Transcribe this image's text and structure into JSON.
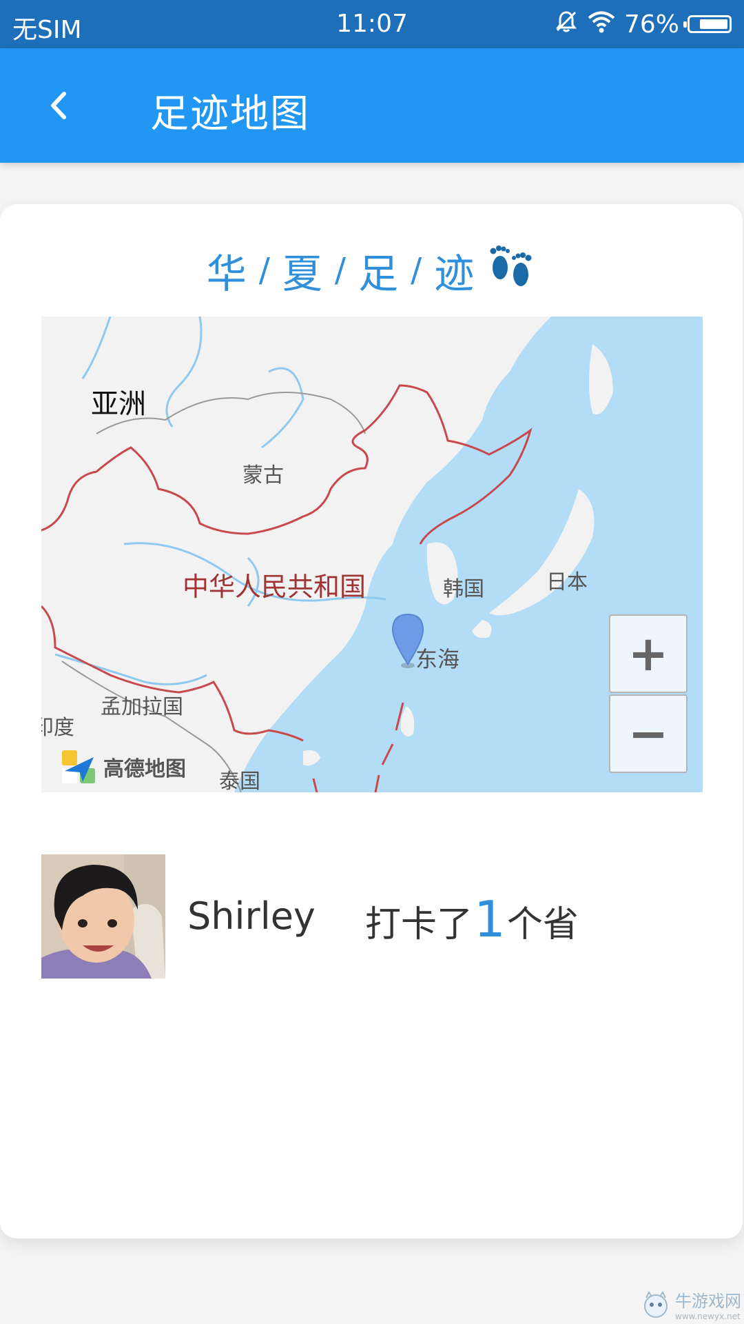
{
  "status_bar": {
    "carrier": "无SIM",
    "time": "11:07",
    "battery_percent": "76%",
    "battery_level": 0.76,
    "icons": [
      "bell-muted-icon",
      "wifi-icon",
      "battery-icon"
    ]
  },
  "header": {
    "title": "足迹地图",
    "back_icon": "chevron-left-icon"
  },
  "card": {
    "heading_chars": [
      "华",
      "夏",
      "足",
      "迹"
    ],
    "heading_separator": "/",
    "heading_icon": "footprints-icon"
  },
  "map": {
    "labels": {
      "asia": "亚洲",
      "mongolia": "蒙古",
      "china": "中华人民共和国",
      "korea": "韩国",
      "japan": "日本",
      "east_sea": "东海",
      "bangladesh": "孟加拉国",
      "india": "印度",
      "thailand": "泰国"
    },
    "zoom_in_label": "+",
    "zoom_out_label": "−",
    "logo_text": "高德地图",
    "marker_icon": "map-pin-icon",
    "colors": {
      "land": "#f2f2f2",
      "sea": "#b3dcf6",
      "border": "#c8494c",
      "marker": "#6d9be6"
    }
  },
  "user": {
    "name": "Shirley",
    "checkin_prefix": "打卡了",
    "checkin_count": "1",
    "checkin_suffix": "个省"
  },
  "watermark": {
    "text": "牛游戏网",
    "url": "www.newyx.net"
  },
  "theme": {
    "status_bar_color": "#1c6fb8",
    "header_color": "#2196f3",
    "accent": "#2f8fdb"
  }
}
